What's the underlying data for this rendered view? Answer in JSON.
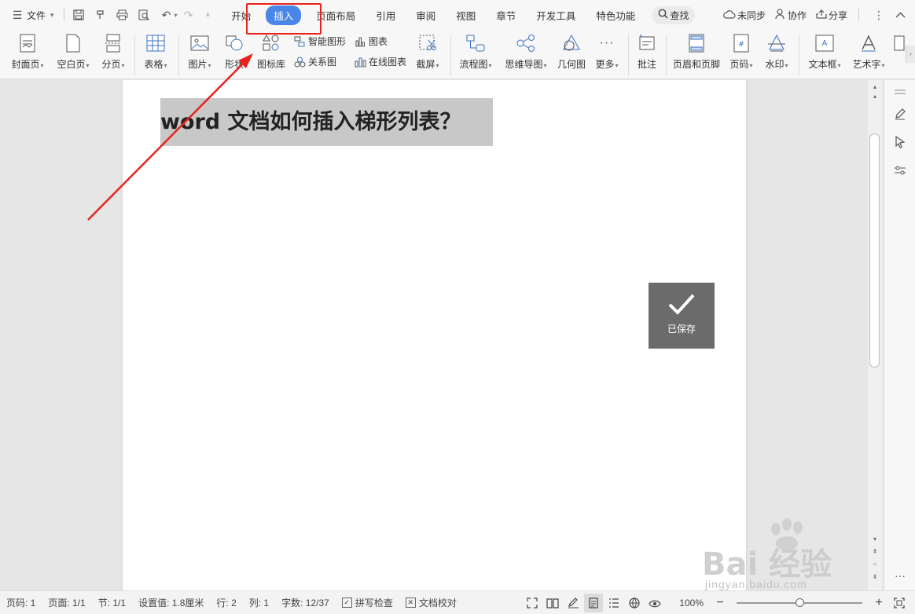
{
  "menubar": {
    "file_label": "文件",
    "tabs": [
      {
        "label": "开始",
        "active": false
      },
      {
        "label": "插入",
        "active": true
      },
      {
        "label": "页面布局",
        "active": false
      },
      {
        "label": "引用",
        "active": false
      },
      {
        "label": "审阅",
        "active": false
      },
      {
        "label": "视图",
        "active": false
      },
      {
        "label": "章节",
        "active": false
      },
      {
        "label": "开发工具",
        "active": false
      },
      {
        "label": "特色功能",
        "active": false
      }
    ],
    "search_label": "查找",
    "sync_label": "未同步",
    "collab_label": "协作",
    "share_label": "分享"
  },
  "ribbon": {
    "cover": "封面页",
    "blank": "空白页",
    "pagebreak": "分页",
    "table": "表格",
    "picture": "图片",
    "shape": "形状",
    "iconlib": "图标库",
    "smartart": "智能图形",
    "chart": "图表",
    "relation": "关系图",
    "onlinechart": "在线图表",
    "screenshot": "截屏",
    "flowchart": "流程图",
    "mindmap": "思维导图",
    "geometry": "几何图",
    "more": "更多",
    "comment": "批注",
    "headerfooter": "页眉和页脚",
    "pagenum": "页码",
    "watermark": "水印",
    "textbox": "文本框",
    "wordart": "艺术字"
  },
  "document": {
    "heading": "word 文档如何插入梯形列表？",
    "saved_label": "已保存"
  },
  "statusbar": {
    "page_num": "页码: 1",
    "pages": "页面: 1/1",
    "section": "节: 1/1",
    "setting": "设置值: 1.8厘米",
    "row": "行: 2",
    "col": "列: 1",
    "wordcount": "字数: 12/37",
    "spellcheck": "拼写检查",
    "proofread": "文档校对",
    "zoom": "100%",
    "zoom_fraction": 0.5
  },
  "watermark": {
    "brand": "Bai 经验",
    "url": "jingyan.baidu.com"
  },
  "colors": {
    "accent": "#4a86e8",
    "highlight_box": "#e8231d",
    "saved_toast": "#6b6b6b"
  }
}
